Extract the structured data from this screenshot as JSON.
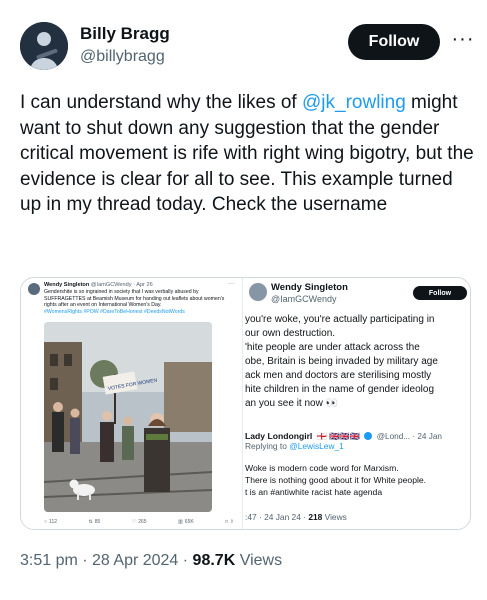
{
  "author": {
    "name": "Billy Bragg",
    "handle": "@billybragg",
    "follow_label": "Follow"
  },
  "tweet": {
    "text_before": "I can understand why the likes of ",
    "mention": "@jk_rowling",
    "text_after": " might want to shut down any suggestion that the gender critical movement is rife with right wing bigotry, but the evidence is clear for all to see. This example turned up in my thread today. Check the username"
  },
  "embedded_left": {
    "name": "Wendy Singleton",
    "handle_time": "@IamGCWendy · Apr 26",
    "text": "Gendershite is so ingrained in society that I was verbally abused by SUFFRAGETTES at Beamish Museum for handing out leaflets about women's rights after an event on International Women's Day.",
    "hashtags": "#WomensRights #POW #DareToBeHonest #DeedsNotWords",
    "sign_text": "VOTES FOR WOMEN",
    "actions": {
      "replies": "112",
      "reposts": "85",
      "likes": "265",
      "views": "65K"
    }
  },
  "embedded_right": {
    "name": "Wendy Singleton",
    "handle": "@IamGCWendy",
    "follow_label": "Follow",
    "body_lines": [
      "you're woke, you're actually participating in",
      "our own destruction.",
      "'hite people are under attack across the",
      "obe, Britain is being invaded by military age",
      "ack men and doctors are sterilising mostly",
      "hite children in the name of gender ideolog",
      "an you see it now 👀"
    ],
    "quote": {
      "name": "Lady Londongirl",
      "flags": "🏴󠁧󠁢󠁥󠁮󠁧󠁿 🇬🇧🇬🇧🇬🇧",
      "handle_time": "@Lond... · 24 Jan",
      "replying_prefix": "Replying to ",
      "replying_handle": "@LewisLew_1",
      "text_lines": [
        "Woke is modern code word for Marxism.",
        "There is nothing good about it for White people.",
        "t is an #antiwhite racist hate agenda"
      ],
      "timestamp": ":47 · 24 Jan 24 · ",
      "views_count": "218",
      "views_label": " Views"
    }
  },
  "footer": {
    "time_date": "3:51 pm · 28 Apr 2024 · ",
    "views_count": "98.7K",
    "views_label": " Views"
  },
  "colors": {
    "accent": "#1d9bf0",
    "text_primary": "#0f1419",
    "text_secondary": "#536471"
  }
}
